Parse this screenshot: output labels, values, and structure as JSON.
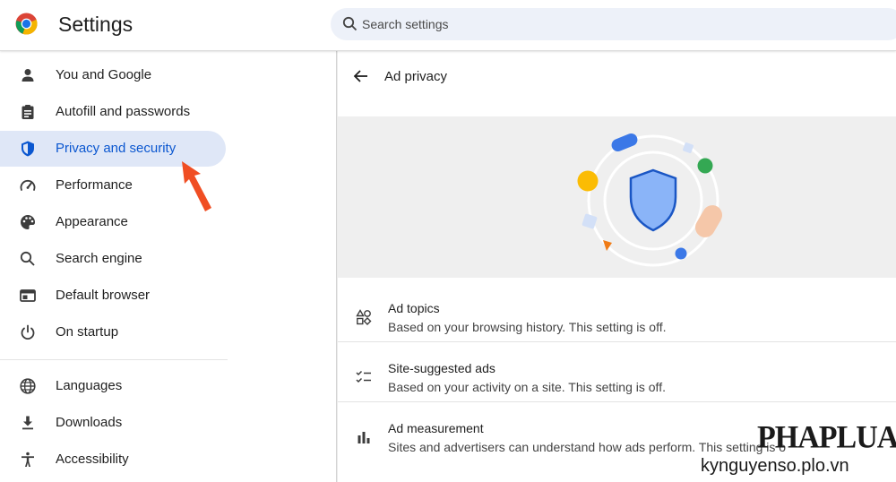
{
  "header": {
    "title": "Settings",
    "search_placeholder": "Search settings"
  },
  "sidebar": {
    "items": [
      {
        "label": "You and Google",
        "icon": "person-icon"
      },
      {
        "label": "Autofill and passwords",
        "icon": "clipboard-icon"
      },
      {
        "label": "Privacy and security",
        "icon": "shield-icon",
        "active": true
      },
      {
        "label": "Performance",
        "icon": "speedometer-icon"
      },
      {
        "label": "Appearance",
        "icon": "palette-icon"
      },
      {
        "label": "Search engine",
        "icon": "search-icon"
      },
      {
        "label": "Default browser",
        "icon": "browser-window-icon"
      },
      {
        "label": "On startup",
        "icon": "power-icon"
      },
      {
        "label": "Languages",
        "icon": "globe-icon"
      },
      {
        "label": "Downloads",
        "icon": "download-icon"
      },
      {
        "label": "Accessibility",
        "icon": "accessibility-icon"
      }
    ]
  },
  "main": {
    "title": "Ad privacy",
    "rows": [
      {
        "title": "Ad topics",
        "subtitle": "Based on your browsing history. This setting is off.",
        "icon": "shapes-icon"
      },
      {
        "title": "Site-suggested ads",
        "subtitle": "Based on your activity on a site. This setting is off.",
        "icon": "checklist-icon"
      },
      {
        "title": "Ad measurement",
        "subtitle": "Sites and advertisers can understand how ads perform. This setting is o",
        "icon": "bar-chart-icon"
      }
    ]
  },
  "watermark": {
    "logo": "PHAPLUAT",
    "url": "kynguyenso.plo.vn"
  },
  "colors": {
    "accent": "#0b57d0",
    "active_bg": "#dfe7f7",
    "search_bg": "#edf1f9",
    "annotation_arrow": "#f04e23"
  }
}
